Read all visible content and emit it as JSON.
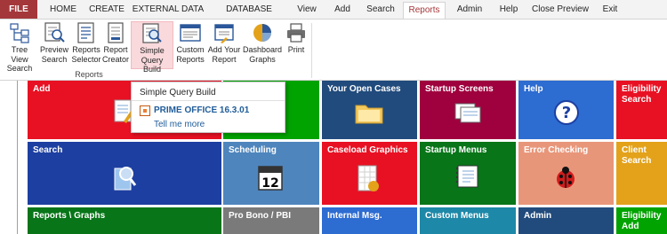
{
  "ribbon": {
    "tabs": [
      {
        "label": "FILE"
      },
      {
        "label": "HOME"
      },
      {
        "label": "CREATE"
      },
      {
        "label": "EXTERNAL DATA"
      },
      {
        "label": "DATABASE TOOLS"
      },
      {
        "label": "View"
      },
      {
        "label": "Add"
      },
      {
        "label": "Search"
      },
      {
        "label": "Reports"
      },
      {
        "label": "Admin"
      },
      {
        "label": "Help"
      },
      {
        "label": "Close Preview"
      },
      {
        "label": "Exit"
      }
    ],
    "active_tab": "Reports",
    "buttons": [
      {
        "line1": "Tree View",
        "line2": "Search",
        "icon": "tree-view-icon"
      },
      {
        "line1": "Preview",
        "line2": "Search",
        "icon": "preview-icon"
      },
      {
        "line1": "Reports",
        "line2": "Selector",
        "icon": "reports-selector-icon"
      },
      {
        "line1": "Report",
        "line2": "Creator",
        "icon": "report-creator-icon"
      },
      {
        "line1": "Simple",
        "line2": "Query Build",
        "icon": "query-build-icon"
      },
      {
        "line1": "Custom",
        "line2": "Reports",
        "icon": "custom-reports-icon"
      },
      {
        "line1": "Add Your",
        "line2": "Report",
        "icon": "add-report-icon"
      },
      {
        "line1": "Dashboard",
        "line2": "Graphs",
        "icon": "pie-chart-icon"
      },
      {
        "line1": "Print",
        "line2": "",
        "icon": "printer-icon"
      }
    ],
    "group_label": "Reports"
  },
  "tooltip": {
    "title": "Simple Query Build",
    "office_name": "PRIME OFFICE 16.3.01",
    "link": "Tell me more"
  },
  "tiles": [
    {
      "line1": "Add",
      "line2": "",
      "color": "#e81123",
      "icon": "notepad-pencil-icon"
    },
    {
      "line1": "",
      "line2": "",
      "color": "#00a300",
      "icon": ""
    },
    {
      "line1": "Your Open Cases",
      "line2": "",
      "color": "#214b7c",
      "icon": "folder-icon"
    },
    {
      "line1": "Startup Screens",
      "line2": "",
      "color": "#9f003e",
      "icon": "screens-icon"
    },
    {
      "line1": "Help",
      "line2": "",
      "color": "#2d6cd1",
      "icon": "help-icon"
    },
    {
      "line1": "Eligibility",
      "line2": "Search",
      "color": "#e81123",
      "icon": ""
    },
    {
      "line1": "Search",
      "line2": "",
      "color": "#1d3fa1",
      "icon": "search-magnifier-icon"
    },
    {
      "line1": "Scheduling",
      "line2": "",
      "color": "#4e85bd",
      "icon": "calendar-icon"
    },
    {
      "line1": "Caseload Graphics",
      "line2": "",
      "color": "#e81123",
      "icon": "spreadsheet-icon"
    },
    {
      "line1": "Startup Menus",
      "line2": "",
      "color": "#077518",
      "icon": "menu-notebook-icon"
    },
    {
      "line1": "Error Checking",
      "line2": "",
      "color": "#e8967a",
      "icon": "ladybug-icon"
    },
    {
      "line1": "Client",
      "line2": "Search",
      "color": "#e3a21a",
      "icon": ""
    },
    {
      "line1": "Reports \\ Graphs",
      "line2": "",
      "color": "#077518",
      "icon": ""
    },
    {
      "line1": "Pro Bono / PBI",
      "line2": "",
      "color": "#7a7a7a",
      "icon": ""
    },
    {
      "line1": "Internal Msg.",
      "line2": "",
      "color": "#2d6cd1",
      "icon": ""
    },
    {
      "line1": "Custom Menus",
      "line2": "",
      "color": "#1e88a8",
      "icon": ""
    },
    {
      "line1": "Admin",
      "line2": "",
      "color": "#214b7c",
      "icon": ""
    },
    {
      "line1": "Eligibility",
      "line2": "Add",
      "color": "#00a300",
      "icon": ""
    }
  ]
}
